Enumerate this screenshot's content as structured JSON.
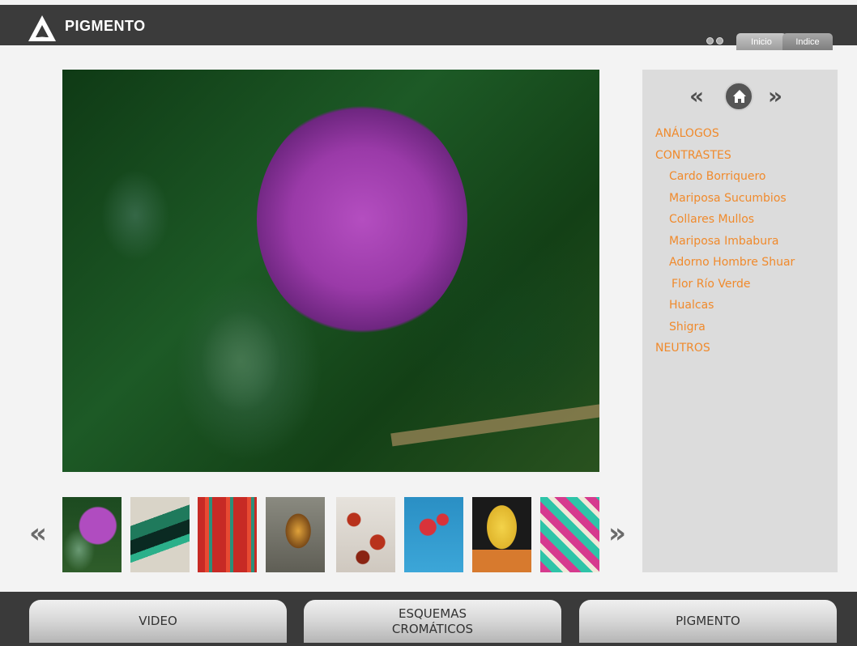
{
  "header": {
    "brand": "PIGMENTO",
    "tabs": [
      {
        "label": "Inicio"
      },
      {
        "label": "Indice"
      }
    ]
  },
  "sidebar": {
    "menu": [
      {
        "label": "ANÁLOGOS",
        "level": 0
      },
      {
        "label": "CONTRASTES",
        "level": 0
      },
      {
        "label": "Cardo Borriquero",
        "level": 1
      },
      {
        "label": "Mariposa Sucumbios",
        "level": 1
      },
      {
        "label": "Collares Mullos",
        "level": 1
      },
      {
        "label": "Mariposa Imbabura",
        "level": 1
      },
      {
        "label": "Adorno Hombre Shuar",
        "level": 1
      },
      {
        "label": "Flor Río Verde",
        "level": 1
      },
      {
        "label": "Hualcas",
        "level": 1
      },
      {
        "label": "Shigra",
        "level": 1
      },
      {
        "label": "NEUTROS",
        "level": 0
      }
    ],
    "menu_color": "#f08a2c"
  },
  "thumbnails": [
    {
      "subject": "thistle-flower"
    },
    {
      "subject": "green-moth"
    },
    {
      "subject": "red-textile"
    },
    {
      "subject": "orange-butterfly"
    },
    {
      "subject": "red-seed-necklace"
    },
    {
      "subject": "red-flower-blue-sky"
    },
    {
      "subject": "yellow-bead-necklaces"
    },
    {
      "subject": "woven-bag"
    }
  ],
  "bottom_nav": {
    "video_label": "VIDEO",
    "esquemas_label": "ESQUEMAS CROMÁTICOS",
    "pigmento_label": "PIGMENTO"
  },
  "colors": {
    "header_bg": "#3b3b3b",
    "sidebar_bg": "#dcdcdc",
    "accent": "#f08a2c"
  }
}
